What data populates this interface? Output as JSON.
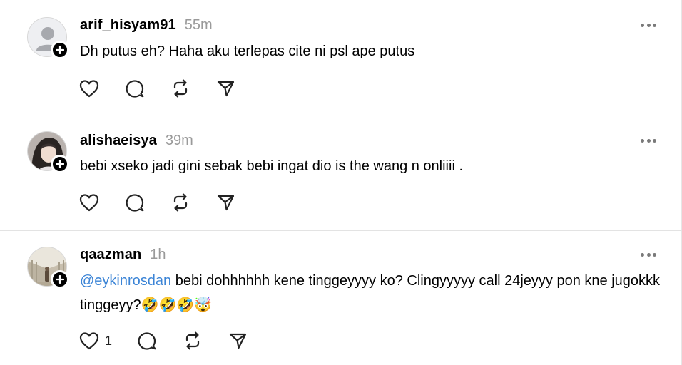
{
  "posts": [
    {
      "username": "arif_hisyam91",
      "time": "55m",
      "text_parts": {
        "mention": "",
        "body": "Dh putus eh? Haha aku terlepas cite ni psl ape putus"
      },
      "like_count": "",
      "avatar_icon": "default-user-avatar"
    },
    {
      "username": "alishaeisya",
      "time": "39m",
      "text_parts": {
        "mention": "",
        "body": "bebi xseko jadi gini sebak bebi ingat dio is the wang n onliiii ."
      },
      "like_count": "",
      "avatar_icon": "profile-photo"
    },
    {
      "username": "qaazman",
      "time": "1h",
      "text_parts": {
        "mention": "@eykinrosdan",
        "body": " bebi dohhhhhh kene tinggeyyyy ko? Clingyyyyy call 24jeyyy pon kne jugokkk tinggeyy?🤣🤣🤣🤯"
      },
      "like_count": "1",
      "avatar_icon": "profile-photo"
    }
  ],
  "icons": {
    "like": "heart-icon",
    "reply": "comment-bubble-icon",
    "repost": "repost-icon",
    "share": "send-icon",
    "more": "more-dots-icon",
    "follow": "plus-icon"
  },
  "colors": {
    "mention": "#3b84d6",
    "time": "#9a9a9a",
    "divider": "#e3e3e3"
  }
}
